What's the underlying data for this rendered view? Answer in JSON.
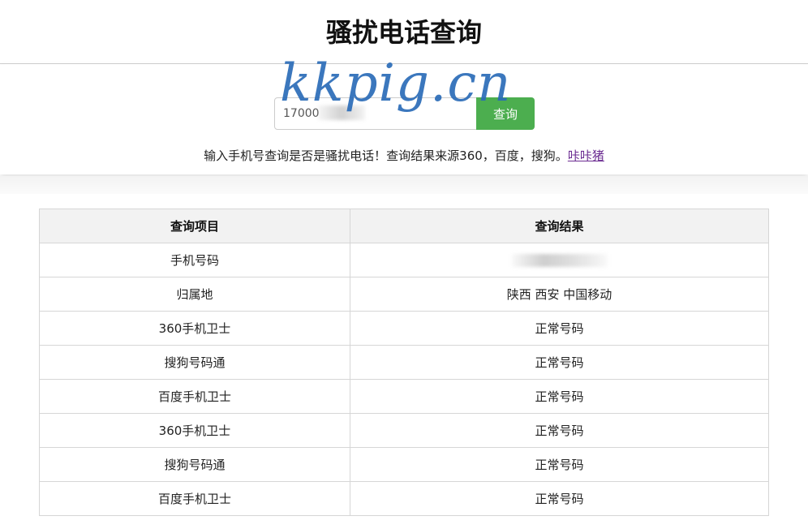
{
  "page": {
    "title": "骚扰电话查询",
    "watermark": "kkpig.cn"
  },
  "search": {
    "input_value": "17000",
    "button_label": "查询",
    "hint": "输入手机号查询是否是骚扰电话！查询结果来源360，百度，搜狗。",
    "hint_link": "咔咔猪"
  },
  "table": {
    "headers": [
      "查询项目",
      "查询结果"
    ],
    "rows": [
      {
        "item": "手机号码",
        "result": ""
      },
      {
        "item": "归属地",
        "result": "陕西 西安 中国移动"
      },
      {
        "item": "360手机卫士",
        "result": "正常号码"
      },
      {
        "item": "搜狗号码通",
        "result": "正常号码"
      },
      {
        "item": "百度手机卫士",
        "result": "正常号码"
      },
      {
        "item": "360手机卫士",
        "result": "正常号码"
      },
      {
        "item": "搜狗号码通",
        "result": "正常号码"
      },
      {
        "item": "百度手机卫士",
        "result": "正常号码"
      }
    ]
  },
  "colors": {
    "button": "#4cae4f",
    "link": "#6b2c91",
    "watermark": "#2b6cb8",
    "header_bg": "#f2f2f2"
  }
}
